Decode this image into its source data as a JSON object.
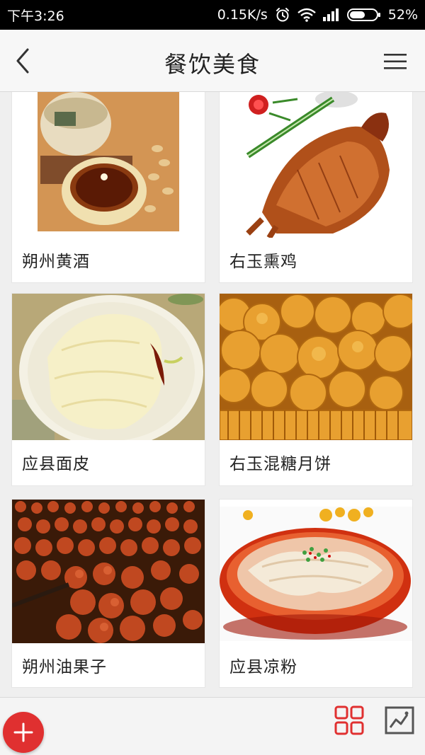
{
  "status_bar": {
    "time": "下午3:26",
    "network_speed": "0.15K/s",
    "battery": "52%",
    "icons": [
      "alarm-icon",
      "wifi-icon",
      "signal-icon",
      "battery-icon"
    ]
  },
  "header": {
    "title": "餐饮美食",
    "back_icon": "back-chevron-icon",
    "menu_icon": "hamburger-menu-icon"
  },
  "items": [
    {
      "name": "朔州黄酒"
    },
    {
      "name": "右玉熏鸡"
    },
    {
      "name": "应县面皮"
    },
    {
      "name": "右玉混糖月饼"
    },
    {
      "name": "朔州油果子"
    },
    {
      "name": "应县凉粉"
    }
  ],
  "bottom_bar": {
    "add_icon": "plus-icon",
    "grid_icon": "grid-view-icon",
    "photo_icon": "image-gallery-icon"
  },
  "colors": {
    "accent": "#e03030",
    "status_bar_bg": "#000000",
    "header_bg": "#f7f7f7",
    "page_bg": "#efefef"
  }
}
